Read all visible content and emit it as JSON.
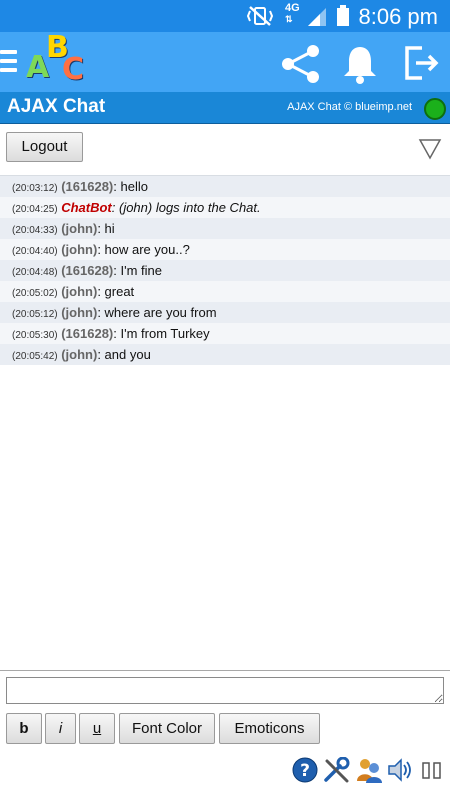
{
  "status_bar": {
    "time": "8:06 pm",
    "network": "4G"
  },
  "app_bar": {
    "logo_letters": [
      "A",
      "B",
      "C"
    ]
  },
  "chat_header": {
    "title": "AJAX Chat",
    "copyright": "AJAX Chat © blueimp.net",
    "status_color": "#1bb01b"
  },
  "toolbar": {
    "logout_label": "Logout"
  },
  "messages": [
    {
      "time": "(20:03:12)",
      "user": "(161628)",
      "text": ": hello"
    },
    {
      "time": "(20:04:25)",
      "user": "ChatBot",
      "text": ": (john) logs into the Chat.",
      "bot": true
    },
    {
      "time": "(20:04:33)",
      "user": "(john)",
      "text": ": hi"
    },
    {
      "time": "(20:04:40)",
      "user": "(john)",
      "text": ": how are you..?"
    },
    {
      "time": "(20:04:48)",
      "user": "(161628)",
      "text": ": I'm fine"
    },
    {
      "time": "(20:05:02)",
      "user": "(john)",
      "text": ": great"
    },
    {
      "time": "(20:05:12)",
      "user": "(john)",
      "text": ": where are you from"
    },
    {
      "time": "(20:05:30)",
      "user": "(161628)",
      "text": ": I'm from Turkey"
    },
    {
      "time": "(20:05:42)",
      "user": "(john)",
      "text": ": and you"
    }
  ],
  "input": {
    "value": "",
    "placeholder": ""
  },
  "format_buttons": {
    "bold": "b",
    "italic": "i",
    "underline": "u",
    "font_color": "Font Color",
    "emoticons": "Emoticons"
  },
  "colors": {
    "status_bar": "#1e88e5",
    "app_bar": "#42a5f5",
    "chat_header": "#1a87d7",
    "bot_name": "#c00000"
  },
  "icons": [
    "menu-icon",
    "share-icon",
    "bell-icon",
    "exit-icon",
    "filter-icon",
    "help-icon",
    "tools-icon",
    "online-users-icon",
    "sound-icon",
    "pause-icon"
  ]
}
